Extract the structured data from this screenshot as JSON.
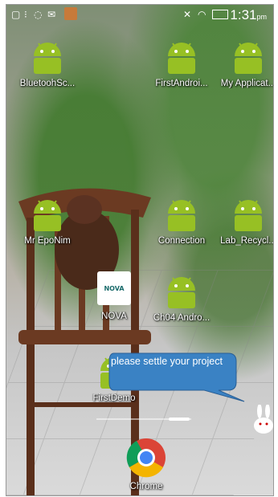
{
  "status_bar": {
    "time": "1:31",
    "time_suffix": "pm",
    "left_icons": [
      "notification-icon",
      "menu-dots-icon",
      "chat-icon",
      "gmail-icon",
      "avatar-icon"
    ],
    "right_icons": [
      "mute-icon",
      "wifi-icon",
      "battery-icon"
    ]
  },
  "apps": [
    {
      "id": "bluetooth",
      "label": "BluetoohSc...",
      "icon": "android-icon"
    },
    {
      "id": "firstandroid",
      "label": "FirstAndroi...",
      "icon": "android-icon"
    },
    {
      "id": "myapplication",
      "label": "My Applicat...",
      "icon": "android-icon"
    },
    {
      "id": "mrepo",
      "label": "Mr EpoNim",
      "icon": "android-icon"
    },
    {
      "id": "connection",
      "label": "Connection",
      "icon": "android-icon"
    },
    {
      "id": "labrecycl",
      "label": "Lab_Recycl...",
      "icon": "android-icon"
    },
    {
      "id": "nova",
      "label": "NOVA",
      "icon": "nova-logo-icon",
      "logo_text": "NOVA"
    },
    {
      "id": "ch04",
      "label": "Ch04 Andro...",
      "icon": "android-icon"
    },
    {
      "id": "firstdemo",
      "label": "FirstDemo",
      "icon": "android-icon"
    }
  ],
  "toast": {
    "message": "please settle your project"
  },
  "dock": {
    "chrome_label": "Chrome"
  },
  "colors": {
    "android_green": "#97c024",
    "toast_bg": "#3a82c4",
    "text": "#ffffff"
  }
}
